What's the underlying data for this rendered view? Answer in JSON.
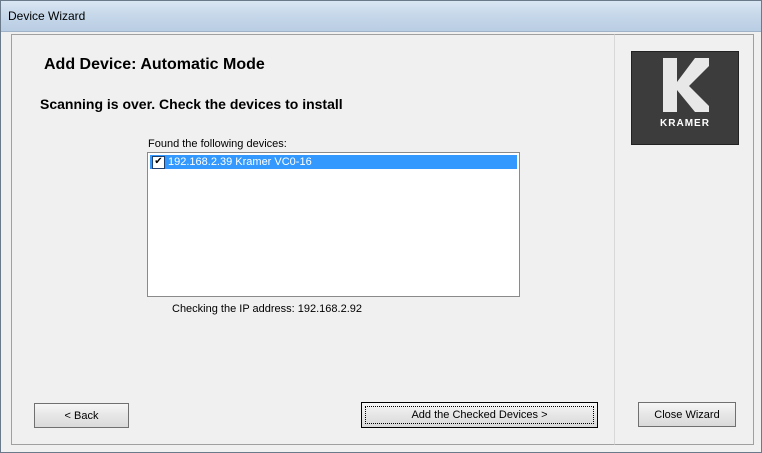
{
  "window": {
    "title": "Device Wizard"
  },
  "main": {
    "heading": "Add Device: Automatic Mode",
    "subheading": "Scanning is over. Check the devices to install",
    "list_caption": "Found the following devices:",
    "devices": [
      {
        "label": "192.168.2.39 Kramer VC0-16",
        "checked": true,
        "selected": true
      }
    ],
    "checking_label": "Checking the IP address:",
    "checking_ip": "192.168.2.92"
  },
  "buttons": {
    "back": "< Back",
    "add": "Add the Checked Devices >",
    "close": "Close Wizard"
  },
  "logo": {
    "text": "KRAMER"
  },
  "colors": {
    "selection": "#3399ff",
    "logo_bg": "#3c3c3c"
  }
}
